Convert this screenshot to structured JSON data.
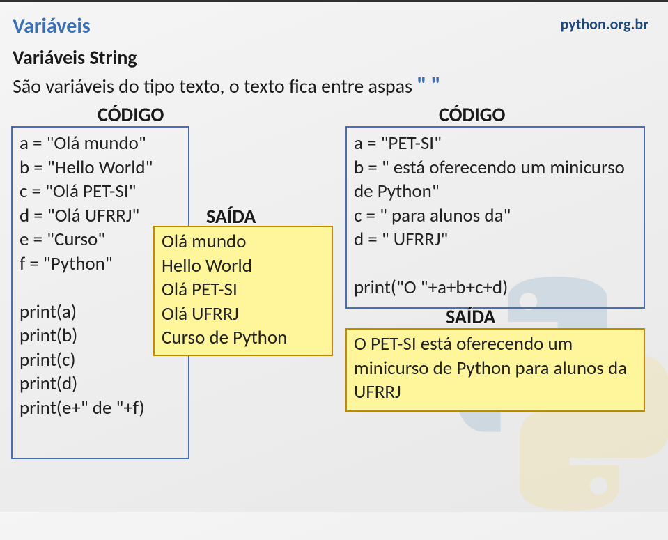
{
  "header": {
    "title": "Variáveis",
    "link": "python.org.br",
    "subtitle": "Variáveis String",
    "intro_text": "São variáveis do tipo texto, o texto fica entre aspas",
    "quote_open": "\"",
    "quote_close": "\""
  },
  "labels": {
    "codigo": "CÓDIGO",
    "saida": "SAÍDA"
  },
  "left": {
    "code": [
      "a = \"Olá mundo\"",
      "b = \"Hello World\"",
      "c = \"Olá PET-SI\"",
      "d = \"Olá UFRRJ\"",
      "e = \"Curso\"",
      "f = \"Python\"",
      "",
      "print(a)",
      "print(b)",
      "print(c)",
      "print(d)",
      "print(e+\" de \"+f)"
    ],
    "output": [
      "Olá mundo",
      "Hello World",
      "Olá PET-SI",
      "Olá UFRRJ",
      "Curso de Python"
    ]
  },
  "right": {
    "code": [
      "a = \"PET-SI\"",
      "b = \" está oferecendo um minicurso de Python\"",
      "c = \" para alunos da\"",
      "d = \" UFRRJ\"",
      "",
      "print(\"O \"+a+b+c+d)"
    ],
    "output": [
      "O PET-SI está oferecendo um minicurso de Python para alunos da UFRRJ"
    ]
  }
}
